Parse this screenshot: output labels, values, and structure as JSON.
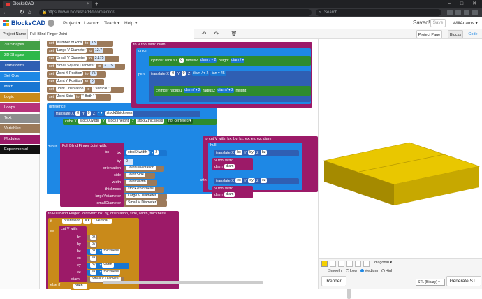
{
  "browser": {
    "tab_title": "BlocksCAD",
    "url": "https://www.blockscad3d.com/editor/",
    "search_placeholder": "Search",
    "tab_close": "×",
    "new_tab": "+",
    "minimize": "–",
    "maximize": "□",
    "close": "✕",
    "back": "←",
    "forward": "→",
    "reload": "↻",
    "home": "⌂",
    "lock": "🔒",
    "search_icon": "⌕"
  },
  "app": {
    "logo_text": "BlocksCAD",
    "menus": [
      "Project ▾",
      "Learn ▾",
      "Teach ▾",
      "Help ▾"
    ],
    "saved_text": "Saved!",
    "save_label": "Save",
    "user": "WillAdams ▾"
  },
  "projectbar": {
    "label": "Project Name",
    "name": "Full Blind Finger Joint",
    "undo": "↶",
    "redo": "↷",
    "delete": "🗑",
    "project_page": "Project Page",
    "blocks": "Blocks",
    "code": "Code"
  },
  "categories": [
    {
      "label": "3D Shapes",
      "color": "#43a047"
    },
    {
      "label": "2D Shapes",
      "color": "#2eb84a"
    },
    {
      "label": "Transforms",
      "color": "#2f5fb3"
    },
    {
      "label": "Set Ops",
      "color": "#1e88e5"
    },
    {
      "label": "Math",
      "color": "#1976d2"
    },
    {
      "label": "Logic",
      "color": "#c98a1a"
    },
    {
      "label": "Loops",
      "color": "#b7327a"
    },
    {
      "label": "Text",
      "color": "#8d8d8d"
    },
    {
      "label": "Variables",
      "color": "#9c7a5a"
    },
    {
      "label": "Modules",
      "color": "#9c1a68"
    },
    {
      "label": "Experimental",
      "color": "#111111"
    }
  ],
  "blocks": {
    "set_vars": [
      {
        "name": "Number of Pins",
        "val": "13"
      },
      {
        "name": "Large V Diameter",
        "val": "12.7"
      },
      {
        "name": "Small V Diameter",
        "val": "3.175"
      },
      {
        "name": "Small Square Diameter",
        "val": "3.175"
      },
      {
        "name": "Joint X Position",
        "val": "75"
      },
      {
        "name": "Joint Y Position",
        "val": "0"
      },
      {
        "name": "Joint Orientation",
        "val": "\" Vertical \""
      },
      {
        "name": "Joint Side",
        "val": "\" Both \""
      }
    ],
    "set_word": "set",
    "to_word": "to",
    "difference": "difference",
    "minus": "minus",
    "translate": "translate",
    "cube": "cube",
    "union": "union",
    "plus": "plus",
    "hull": "hull",
    "with": "with",
    "if_word": "if",
    "do_word": "do",
    "else_if": "else if",
    "cylinder": "cylinder",
    "x": "X",
    "y": "Y",
    "z": "Z",
    "zero": "0",
    "minus_op": "- ▾",
    "times_op": "× ▾",
    "div_op": "/ ▾",
    "eq_op": "= ▾",
    "stockZthickness": "stockZthickness",
    "stockXwidth": "stockXwidth",
    "stockYheight": "stockYheight",
    "not_centered": "not centered ▾",
    "fbfj_call": "Full Blind Finger Joint with:",
    "fbfj_params": [
      {
        "k": "bx",
        "v": "stockXwidth",
        "v2": "2"
      },
      {
        "k": "by",
        "v": "0"
      },
      {
        "k": "orientation",
        "v": "Joint Orientation"
      },
      {
        "k": "side",
        "v": "Joint Side"
      },
      {
        "k": "width",
        "v": "Joint Width"
      },
      {
        "k": "thickness",
        "v": "stockZthickness"
      },
      {
        "k": "largeVdiameter",
        "v": "Large V Diameter"
      },
      {
        "k": "smallDiameter",
        "v": "Small V Diameter"
      }
    ],
    "vtool_def": "to V tool with: diam",
    "vtool_call": "V tool with:",
    "cut_v_def": "to cut V with: bx, by, bz, ex, ey, ez, diam",
    "fbfj_def": "to Full Blind Finger Joint with: bx, by, orientation, side, width, thickness...",
    "radius1": "radius1",
    "radius2": "radius2",
    "height": "height",
    "diam": "diam",
    "two": "2",
    "tan": "tan ▾",
    "fortyfive": "45",
    "cut_v": "cut V with:",
    "cutv_params": [
      "bx",
      "by",
      "bz",
      "ex",
      "ey",
      "ez",
      "diam"
    ],
    "bx": "bx",
    "by": "by",
    "bz": "bz",
    "ex": "ex",
    "ey": "ey",
    "ez": "ez",
    "thickness": "thickness",
    "width": "width",
    "orientation": "orientation",
    "vertical": "\" Vertical \"",
    "small_v": "Small V Diameter",
    "orien": "orien..."
  },
  "viewer": {
    "diagonal": "diagonal ▾",
    "smooth_label": "Smooth:",
    "low": "Low",
    "medium": "Medium",
    "high": "High",
    "render": "Render",
    "format": "STL (Binary) ▾",
    "generate": "Generate STL",
    "part_color": "#f5d000",
    "zoom_in": "+",
    "zoom_out": "−",
    "zoom_reset": "⊙"
  }
}
